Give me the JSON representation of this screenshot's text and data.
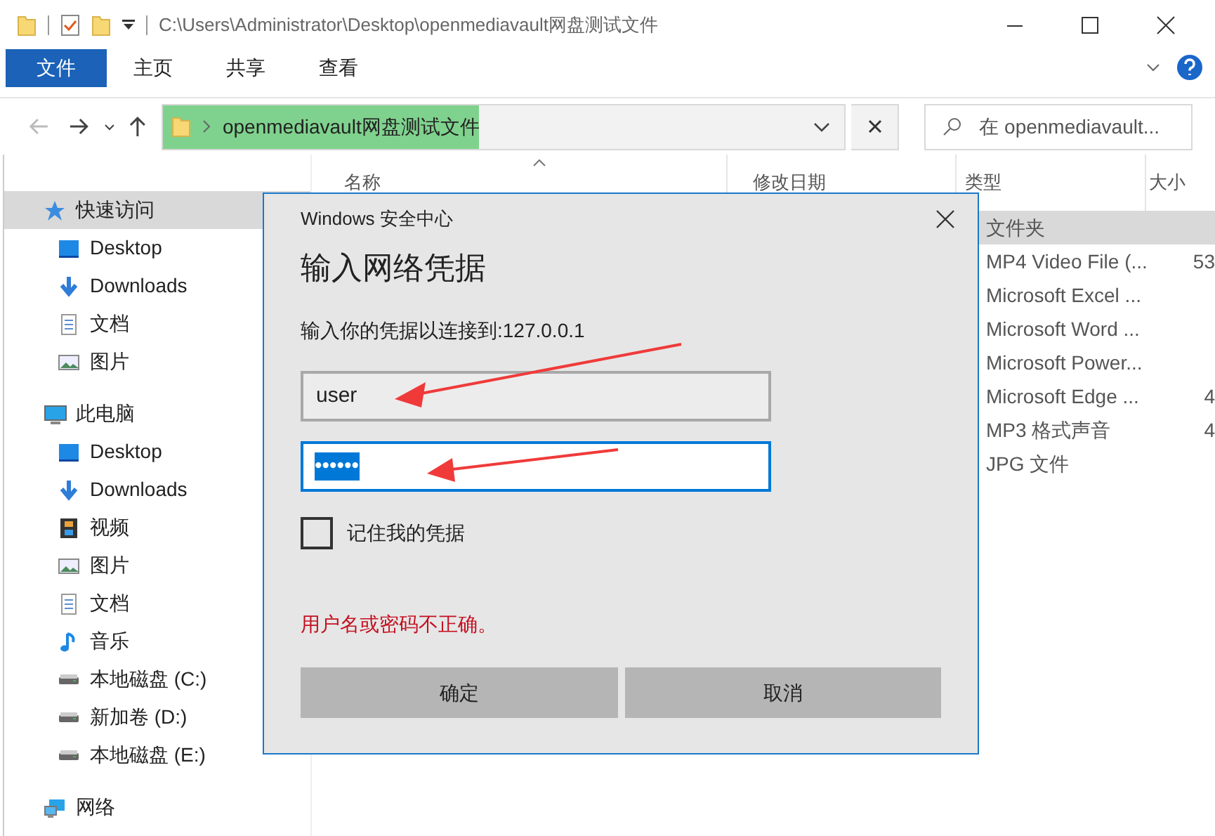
{
  "window": {
    "title": "C:\\Users\\Administrator\\Desktop\\openmediavault网盘测试文件"
  },
  "ribbon": {
    "tabs": [
      {
        "label": "文件",
        "selected": true
      },
      {
        "label": "主页",
        "selected": false
      },
      {
        "label": "共享",
        "selected": false
      },
      {
        "label": "查看",
        "selected": false
      }
    ]
  },
  "address_bar": {
    "path": "openmediavault网盘测试文件"
  },
  "search": {
    "placeholder": "在 openmediavault..."
  },
  "sidebar": {
    "items": [
      {
        "label": "快速访问",
        "kind": "star",
        "selected": true,
        "children": [
          {
            "label": "Desktop",
            "kind": "desktop",
            "selected": false
          },
          {
            "label": "Downloads",
            "kind": "download",
            "selected": false
          },
          {
            "label": "文档",
            "kind": "document",
            "selected": false
          },
          {
            "label": "图片",
            "kind": "image",
            "selected": false
          }
        ]
      },
      {
        "label": "此电脑",
        "kind": "computer",
        "selected": false,
        "children": [
          {
            "label": "Desktop",
            "kind": "desktop",
            "selected": false
          },
          {
            "label": "Downloads",
            "kind": "download",
            "selected": false
          },
          {
            "label": "视频",
            "kind": "film",
            "selected": false
          },
          {
            "label": "图片",
            "kind": "image",
            "selected": false
          },
          {
            "label": "文档",
            "kind": "document",
            "selected": false
          },
          {
            "label": "音乐",
            "kind": "music",
            "selected": false
          },
          {
            "label": "本地磁盘 (C:)",
            "kind": "drive",
            "selected": false
          },
          {
            "label": "新加卷 (D:)",
            "kind": "drive",
            "selected": false
          },
          {
            "label": "本地磁盘 (E:)",
            "kind": "drive",
            "selected": false
          }
        ]
      },
      {
        "label": "网络",
        "kind": "network",
        "selected": false
      }
    ]
  },
  "file_list": {
    "columns": [
      "名称",
      "修改日期",
      "类型",
      "大小"
    ],
    "rows": [
      {
        "type": "文件夹",
        "selected": true
      },
      {
        "type": "MP4 Video File (...",
        "size": "53",
        "selected": false
      },
      {
        "type": "Microsoft Excel ...",
        "selected": false
      },
      {
        "type": "Microsoft Word ...",
        "selected": false
      },
      {
        "type": "Microsoft Power...",
        "selected": false
      },
      {
        "type": "Microsoft Edge ...",
        "size": "4",
        "selected": false
      },
      {
        "type": "MP3 格式声音",
        "size": "4",
        "selected": false
      },
      {
        "type": "JPG 文件",
        "selected": false
      }
    ]
  },
  "dialog": {
    "caption": "Windows 安全中心",
    "heading": "输入网络凭据",
    "prompt": "输入你的凭据以连接到:127.0.0.1",
    "username": "user",
    "password": "••••••",
    "remember": {
      "label": "记住我的凭据",
      "checked": false
    },
    "error": "用户名或密码不正确。",
    "buttons": [
      "确定",
      "取消"
    ]
  }
}
